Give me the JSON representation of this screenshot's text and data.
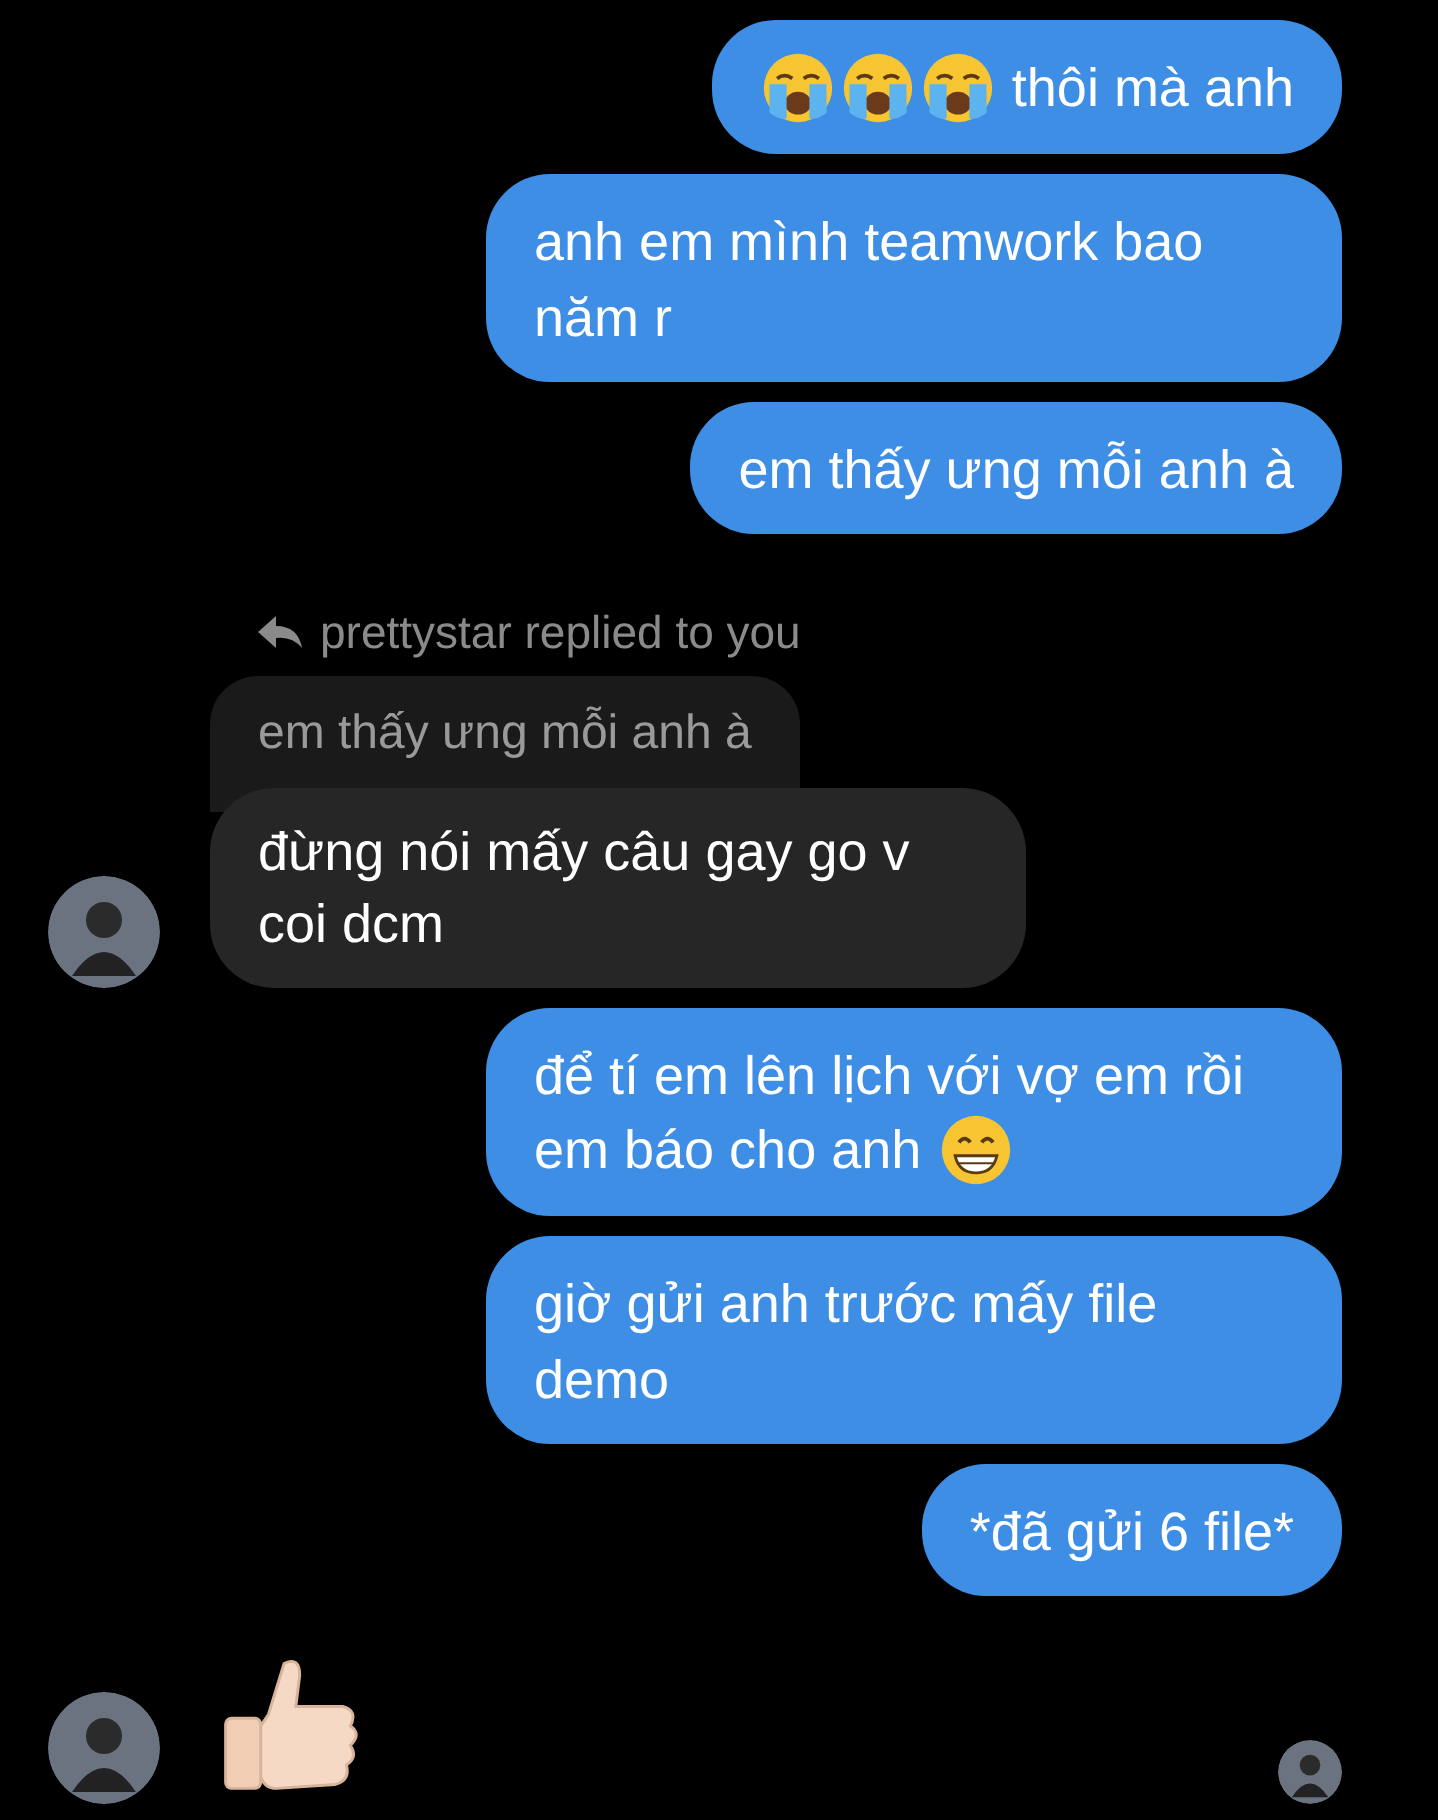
{
  "messages": [
    {
      "kind": "outgoing",
      "parts": [
        {
          "kind": "crying-face"
        },
        {
          "kind": "crying-face"
        },
        {
          "kind": "crying-face"
        },
        {
          "kind": "text",
          "text": "thôi mà anh"
        }
      ]
    },
    {
      "kind": "outgoing",
      "parts": [
        {
          "kind": "text",
          "text": "anh em mình teamwork bao năm r"
        }
      ]
    },
    {
      "kind": "outgoing",
      "parts": [
        {
          "kind": "text",
          "text": "em thấy ưng mỗi anh à"
        }
      ]
    },
    {
      "kind": "reply",
      "label": "prettystar replied to you",
      "quote": "em thấy ưng mỗi anh à",
      "text": "đừng nói mấy câu gay go v coi dcm"
    },
    {
      "kind": "outgoing",
      "parts": [
        {
          "kind": "text",
          "text": "để tí em lên lịch với vợ em rồi em báo cho anh"
        },
        {
          "kind": "grin-face"
        }
      ]
    },
    {
      "kind": "outgoing",
      "parts": [
        {
          "kind": "text",
          "text": "giờ gửi anh trước mấy file demo"
        }
      ]
    },
    {
      "kind": "outgoing",
      "parts": [
        {
          "kind": "text",
          "text": "*đã gửi 6 file*"
        }
      ]
    },
    {
      "kind": "incoming-sticker",
      "parts": [
        {
          "kind": "thumbs-up"
        }
      ]
    }
  ],
  "seen": true
}
